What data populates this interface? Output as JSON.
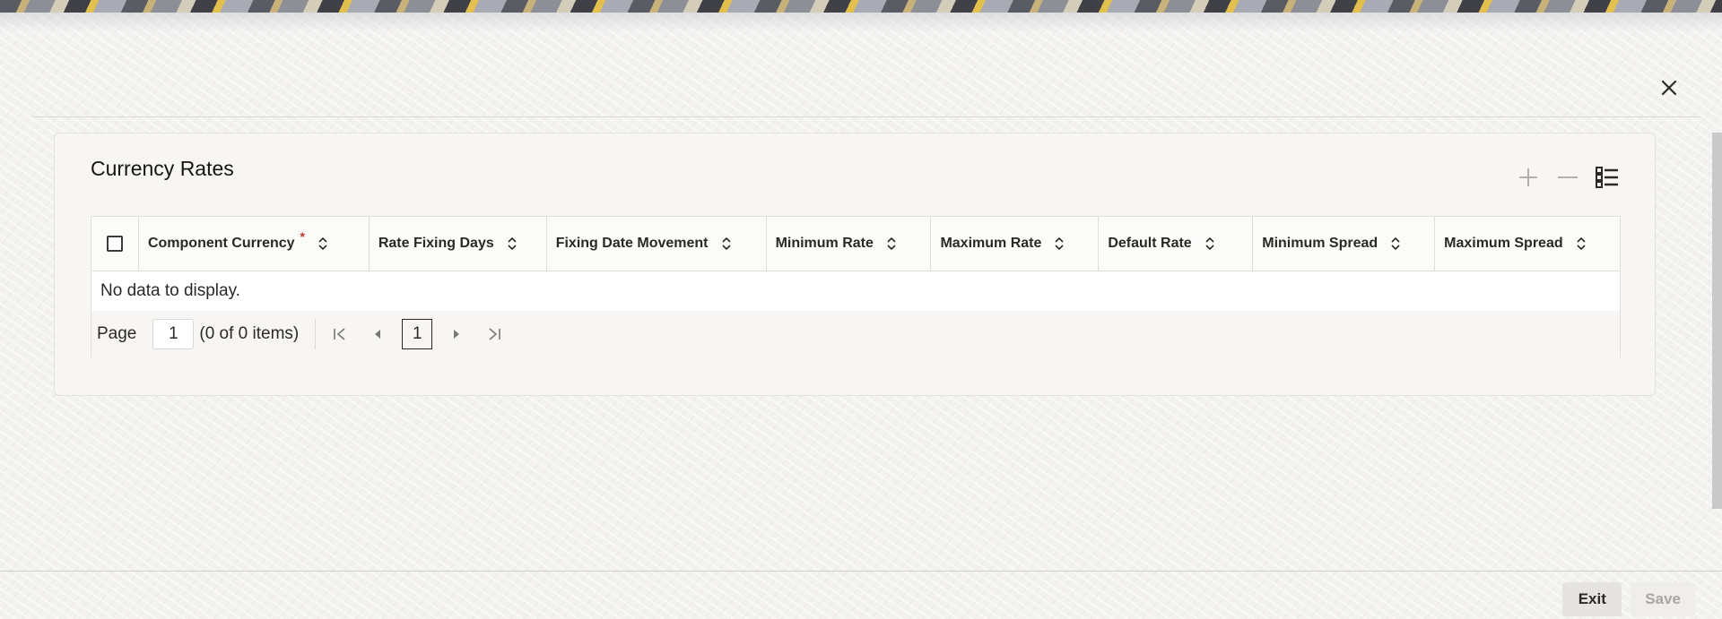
{
  "panel": {
    "title": "Currency Rates"
  },
  "toolbar": {
    "icons": [
      "plus-icon",
      "minus-icon",
      "list-view-icon"
    ]
  },
  "table": {
    "columns": [
      {
        "label": "Component Currency",
        "required": true
      },
      {
        "label": "Rate Fixing Days",
        "required": false
      },
      {
        "label": "Fixing Date Movement",
        "required": false
      },
      {
        "label": "Minimum Rate",
        "required": false
      },
      {
        "label": "Maximum Rate",
        "required": false
      },
      {
        "label": "Default Rate",
        "required": false
      },
      {
        "label": "Minimum Spread",
        "required": false
      },
      {
        "label": "Maximum Spread",
        "required": false
      }
    ],
    "required_mark": "*",
    "empty_message": "No data to display."
  },
  "pager": {
    "page_label": "Page",
    "page_value": "1",
    "items_summary": "(0 of 0 items)",
    "current_page": "1"
  },
  "footer": {
    "exit_label": "Exit",
    "save_label": "Save"
  },
  "colors": {
    "required": "#c0392b",
    "save_disabled_text": "#a9a6a1"
  }
}
